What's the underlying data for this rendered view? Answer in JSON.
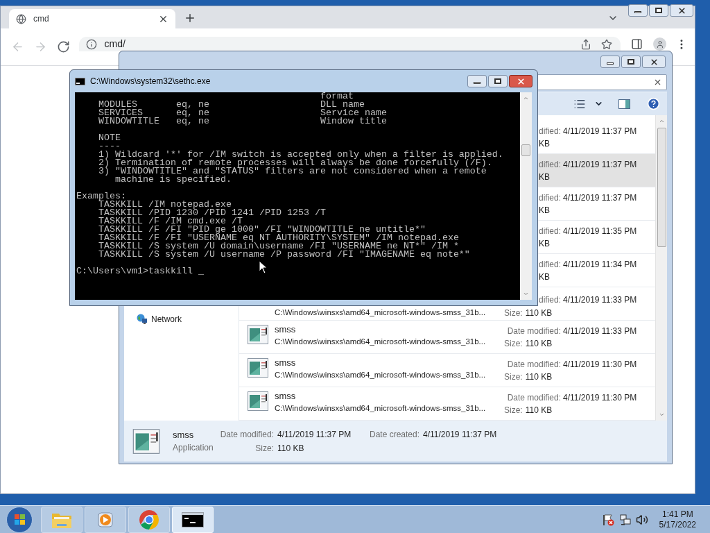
{
  "browser": {
    "tab": {
      "title": "cmd",
      "selected": true
    },
    "nav_buttons": [
      {
        "kind": "back",
        "disabled": true
      },
      {
        "kind": "forward",
        "disabled": true
      },
      {
        "kind": "reload",
        "disabled": false
      }
    ],
    "address": "cmd/"
  },
  "explorer": {
    "nav_items": [
      {
        "label": "Network"
      }
    ],
    "rows": [
      {
        "kind": "covered",
        "selected": false,
        "date_label": "dified:",
        "date": "4/11/2019 11:37 PM",
        "size": "KB"
      },
      {
        "kind": "covered",
        "selected": true,
        "date_label": "dified:",
        "date": "4/11/2019 11:37 PM",
        "size": "KB"
      },
      {
        "kind": "covered",
        "selected": false,
        "date_label": "dified:",
        "date": "4/11/2019 11:37 PM",
        "size": "KB"
      },
      {
        "kind": "covered",
        "selected": false,
        "date_label": "dified:",
        "date": "4/11/2019 11:35 PM",
        "size": "KB"
      },
      {
        "kind": "covered",
        "selected": false,
        "date_label": "dified:",
        "date": "4/11/2019 11:34 PM",
        "size": "KB"
      },
      {
        "kind": "lower",
        "selected": false,
        "path": "C:\\Windows\\winsxs\\amd64_microsoft-windows-smss_31b...",
        "date_label": "dified:",
        "date": "4/11/2019 11:33 PM",
        "size_label": "Size:",
        "size": "110 KB"
      },
      {
        "kind": "full",
        "selected": false,
        "name": "smss",
        "path": "C:\\Windows\\winsxs\\amd64_microsoft-windows-smss_31b...",
        "date_label": "Date modified:",
        "date": "4/11/2019 11:33 PM",
        "size_label": "Size:",
        "size": "110 KB"
      },
      {
        "kind": "full",
        "selected": false,
        "name": "smss",
        "path": "C:\\Windows\\winsxs\\amd64_microsoft-windows-smss_31b...",
        "date_label": "Date modified:",
        "date": "4/11/2019 11:30 PM",
        "size_label": "Size:",
        "size": "110 KB"
      },
      {
        "kind": "full",
        "selected": false,
        "name": "smss",
        "path": "C:\\Windows\\winsxs\\amd64_microsoft-windows-smss_31b...",
        "date_label": "Date modified:",
        "date": "4/11/2019 11:30 PM",
        "size_label": "Size:",
        "size": "110 KB"
      }
    ],
    "details": {
      "name": "smss",
      "type": "Application",
      "modified_label": "Date modified:",
      "modified": "4/11/2019 11:37 PM",
      "created_label": "Date created:",
      "created": "4/11/2019 11:37 PM",
      "size_label": "Size:",
      "size": "110 KB"
    }
  },
  "console": {
    "title": "C:\\Windows\\system32\\sethc.exe",
    "blocks": [
      [
        "                                            format",
        "    MODULES       eq, ne                    DLL name",
        "    SERVICES      eq, ne                    Service name",
        "    WINDOWTITLE   eq, ne                    Window title"
      ],
      [
        "    NOTE",
        "    ----",
        "    1) Wildcard '*' for /IM switch is accepted only when a filter is applied.",
        "    2) Termination of remote processes will always be done forcefully (/F).",
        "    3) \"WINDOWTITLE\" and \"STATUS\" filters are not considered when a remote",
        "       machine is specified."
      ],
      [
        "Examples:",
        "    TASKKILL /IM notepad.exe",
        "    TASKKILL /PID 1230 /PID 1241 /PID 1253 /T",
        "    TASKKILL /F /IM cmd.exe /T",
        "    TASKKILL /F /FI \"PID ge 1000\" /FI \"WINDOWTITLE ne untitle*\"",
        "    TASKKILL /F /FI \"USERNAME eq NT AUTHORITY\\SYSTEM\" /IM notepad.exe",
        "    TASKKILL /S system /U domain\\username /FI \"USERNAME ne NT*\" /IM *",
        "    TASKKILL /S system /U username /P password /FI \"IMAGENAME eq note*\""
      ],
      [
        "C:\\Users\\vm1>taskkill _"
      ]
    ]
  },
  "taskbar": {
    "apps": [
      {
        "kind": "explorer",
        "selected": false
      },
      {
        "kind": "media",
        "selected": false
      },
      {
        "kind": "chrome",
        "selected": false
      },
      {
        "kind": "cmd",
        "selected": true
      }
    ],
    "clock": {
      "time": "1:41 PM",
      "date": "5/17/2022"
    }
  }
}
